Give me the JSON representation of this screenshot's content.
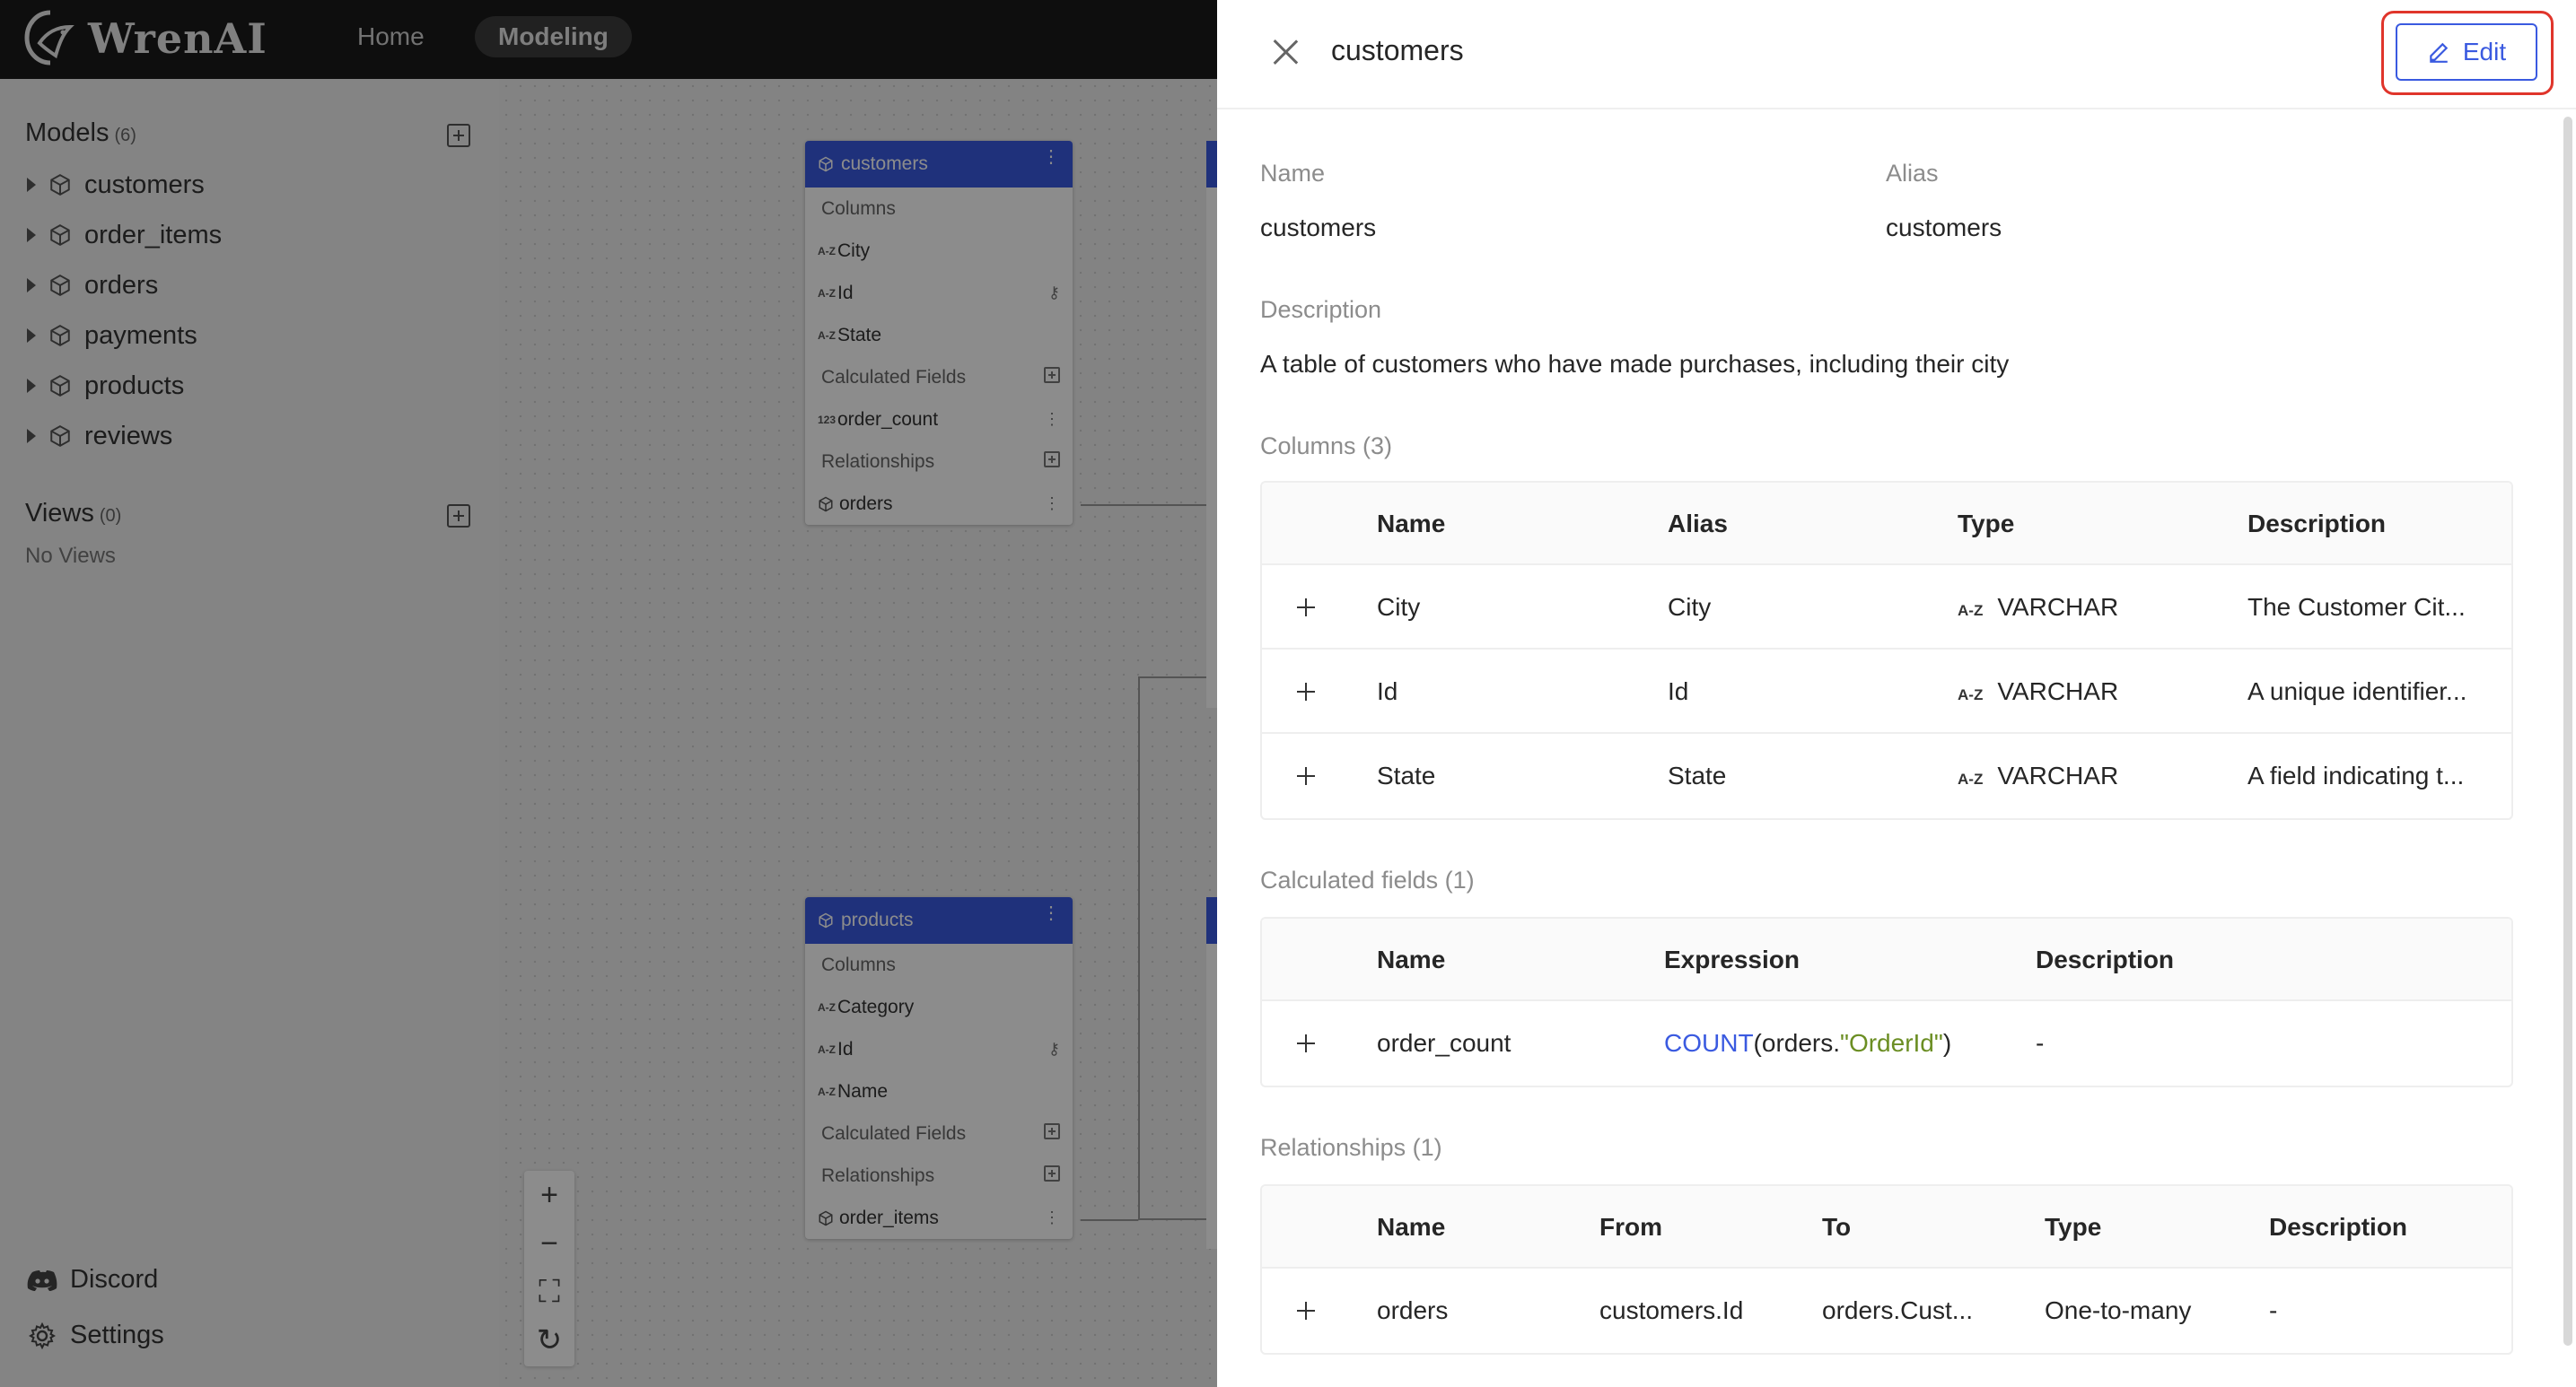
{
  "app": {
    "name": "WrenAI"
  },
  "nav": {
    "home": "Home",
    "modeling": "Modeling"
  },
  "sidebar": {
    "models_title": "Models",
    "models_count": "(6)",
    "models": [
      "customers",
      "order_items",
      "orders",
      "payments",
      "products",
      "reviews"
    ],
    "views_title": "Views",
    "views_count": "(0)",
    "no_views": "No Views",
    "discord": "Discord",
    "settings": "Settings"
  },
  "canvas": {
    "customers_node": {
      "title": "customers",
      "columns_label": "Columns",
      "columns": [
        {
          "type": "A-Z",
          "name": "City"
        },
        {
          "type": "A-Z",
          "name": "Id"
        },
        {
          "type": "A-Z",
          "name": "State"
        }
      ],
      "calc_label": "Calculated Fields",
      "calc": [
        {
          "type": "123",
          "name": "order_count"
        }
      ],
      "rel_label": "Relationships",
      "rels": [
        {
          "name": "orders"
        }
      ]
    },
    "products_node": {
      "title": "products",
      "columns_label": "Columns",
      "columns": [
        {
          "type": "A-Z",
          "name": "Category"
        },
        {
          "type": "A-Z",
          "name": "Id"
        },
        {
          "type": "A-Z",
          "name": "Name"
        }
      ],
      "calc_label": "Calculated Fields",
      "rel_label": "Relationships",
      "rels": [
        {
          "name": "order_items"
        }
      ]
    }
  },
  "drawer": {
    "title": "customers",
    "edit_label": "Edit",
    "name_label": "Name",
    "name_value": "customers",
    "alias_label": "Alias",
    "alias_value": "customers",
    "description_label": "Description",
    "description_value": "A table of customers who have made purchases, including their city",
    "columns_title": "Columns (3)",
    "columns_headers": {
      "name": "Name",
      "alias": "Alias",
      "type": "Type",
      "description": "Description"
    },
    "columns": [
      {
        "name": "City",
        "alias": "City",
        "type_icon": "A-Z",
        "type": "VARCHAR",
        "description": "The Customer Cit..."
      },
      {
        "name": "Id",
        "alias": "Id",
        "type_icon": "A-Z",
        "type": "VARCHAR",
        "description": "A unique identifier..."
      },
      {
        "name": "State",
        "alias": "State",
        "type_icon": "A-Z",
        "type": "VARCHAR",
        "description": "A field indicating t..."
      }
    ],
    "calc_title": "Calculated fields (1)",
    "calc_headers": {
      "name": "Name",
      "expression": "Expression",
      "description": "Description"
    },
    "calc": [
      {
        "name": "order_count",
        "expr_fn": "COUNT",
        "expr_open": "(orders.",
        "expr_str": "\"OrderId\"",
        "expr_close": ")",
        "description": "-"
      }
    ],
    "rel_title": "Relationships (1)",
    "rel_headers": {
      "name": "Name",
      "from": "From",
      "to": "To",
      "type": "Type",
      "description": "Description"
    },
    "rels": [
      {
        "name": "orders",
        "from": "customers.Id",
        "to": "orders.Cust...",
        "type": "One-to-many",
        "description": "-"
      }
    ]
  },
  "colors": {
    "accent": "#3a5ae0",
    "highlight": "#e0352b",
    "topbar": "#1a1a1a"
  }
}
